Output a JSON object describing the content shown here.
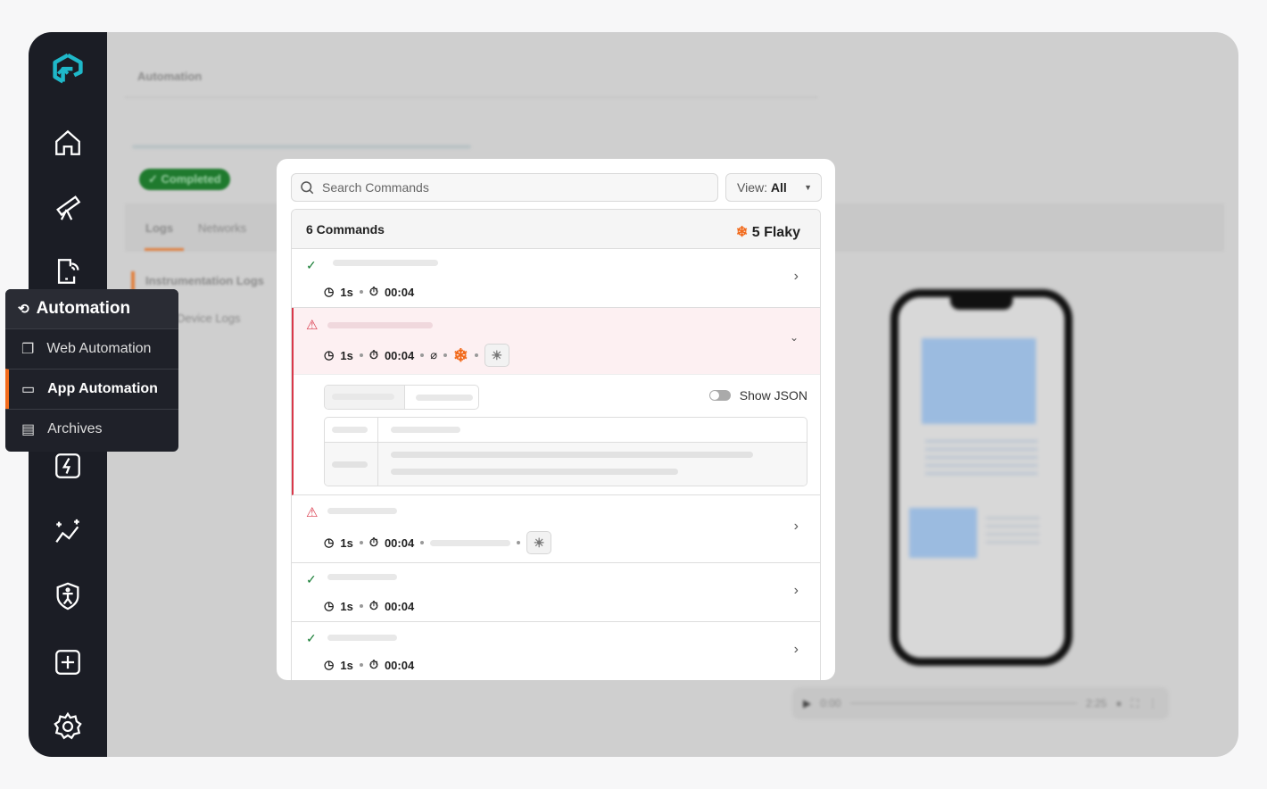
{
  "background": {
    "page_title": "Automation",
    "status_badge": "Completed",
    "tabs": [
      "Logs",
      "Networks"
    ],
    "log_sections": [
      "Instrumentation Logs",
      "Device Logs"
    ],
    "video": {
      "current_time": "0:00",
      "duration": "2:25"
    }
  },
  "sidebar": {
    "logo": "logo-icon",
    "icons": [
      "home-icon",
      "telescope-icon",
      "device-signal-icon",
      "bolt-icon",
      "sparkle-graph-icon",
      "accessibility-shield-icon",
      "plus-square-icon",
      "gear-icon"
    ]
  },
  "flyout": {
    "title": "Automation",
    "items": [
      {
        "label": "Web Automation",
        "active": false
      },
      {
        "label": "App Automation",
        "active": true
      },
      {
        "label": "Archives",
        "active": false
      }
    ],
    "accent": "#f26a1b"
  },
  "commands": {
    "search_placeholder": "Search Commands",
    "view_label": "View:",
    "view_value": "All",
    "count_label": "6 Commands",
    "flaky_label": "5 Flaky",
    "show_json": "Show JSON",
    "rows": [
      {
        "status": "passed",
        "duration": "1s",
        "time": "00:04"
      },
      {
        "status": "failed",
        "duration": "1s",
        "time": "00:04",
        "expanded": true
      },
      {
        "status": "failed",
        "duration": "1s",
        "time": "00:04"
      },
      {
        "status": "passed",
        "duration": "1s",
        "time": "00:04"
      },
      {
        "status": "passed",
        "duration": "1s",
        "time": "00:04"
      }
    ]
  },
  "colors": {
    "success": "#1a7f37",
    "error": "#d9384a",
    "flaky": "#f26a1b",
    "brand": "#1fb8c9"
  }
}
